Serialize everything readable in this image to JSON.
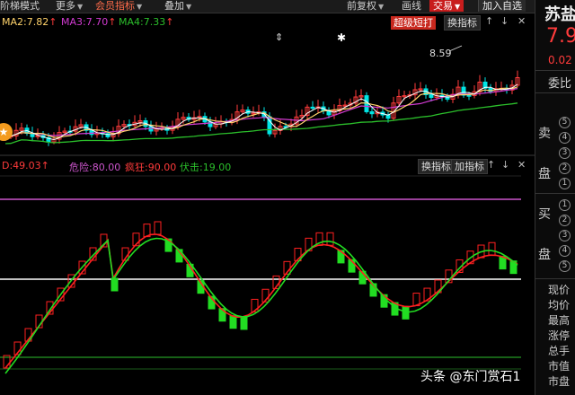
{
  "toolbar": {
    "items": [
      "阶梯模式",
      "更多",
      "会员指标",
      "叠加",
      "前复权",
      "画线",
      "交易",
      "加入自选"
    ]
  },
  "ma_legend": {
    "ma2": "MA2:7.82",
    "ma3": "MA3:7.70",
    "ma4": "MA4:7.33",
    "up_arrow": "↑"
  },
  "main_chart": {
    "high_label": "8.59",
    "buttons": {
      "super": "超级短打",
      "switch": "换指标"
    }
  },
  "indicator_legend": {
    "d": "D:49.03",
    "danger": "危险:80.00",
    "crazy": "疯狂:90.00",
    "ambush": "伏击:19.00",
    "up_arrow": "↑",
    "buttons": {
      "switch": "换指标",
      "add": "加指标"
    }
  },
  "right_panel": {
    "stock_name": "苏盐",
    "price": "7.9",
    "change": "0.02",
    "wei_label": "委比",
    "sell_label": "卖",
    "pan_label": "盘",
    "buy_label": "买",
    "pan_label2": "盘",
    "sell_levels": [
      "5",
      "4",
      "3",
      "2",
      "1"
    ],
    "buy_levels": [
      "1",
      "2",
      "3",
      "4",
      "5"
    ],
    "stats": [
      "现价",
      "均价",
      "最高",
      "涨停",
      "总手",
      "市值",
      "市盘"
    ]
  },
  "watermark": "头条 @东门赏石1",
  "colors": {
    "up": "#ff3b3b",
    "down": "#00e5e5",
    "k_line": "#ff2020",
    "d_line": "#22dd22",
    "ma2": "#ffd36b",
    "ma3": "#d13ad1",
    "ma4": "#2bbf2b",
    "danger_line": "#cc55cc",
    "mid_line": "#ffffff"
  }
}
